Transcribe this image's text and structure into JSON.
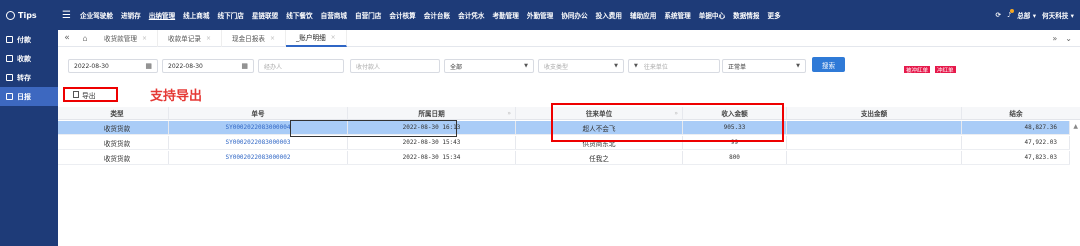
{
  "app": {
    "brand": "Tips",
    "menu_toggle": "☰"
  },
  "nav": [
    "企业驾驶舱",
    "进销存",
    "出纳管理",
    "线上商城",
    "线下门店",
    "星链联盟",
    "线下餐饮",
    "自营商城",
    "自营门店",
    "会计核算",
    "会计台账",
    "会计凭水",
    "考勤管理",
    "外勤管理",
    "协同办公",
    "投入费用",
    "辅助应用",
    "系统管理",
    "单据中心",
    "数据情报",
    "更多"
  ],
  "nav_active_index": 2,
  "top_right": {
    "user_label": "总部 ▾",
    "company_label": "何天科技 ▾"
  },
  "sidebar": [
    {
      "label": "付款"
    },
    {
      "label": "收款"
    },
    {
      "label": "转存"
    },
    {
      "label": "日报"
    }
  ],
  "sidebar_active_index": 3,
  "tabs": [
    {
      "label": "收货款管理"
    },
    {
      "label": "收款单记录"
    },
    {
      "label": "现金日报表"
    },
    {
      "label": "_账户明细"
    }
  ],
  "tab_active_index": 3,
  "filters": {
    "date_from": "2022-08-30",
    "date_to": "2022-08-30",
    "handler_placeholder": "经办人",
    "payee_placeholder": "收付款人",
    "account_select": "全部",
    "type_placeholder": "收支类型",
    "partner_placeholder": "往来单位",
    "status_select": "正常单",
    "search_label": "搜索",
    "tag_red": "被冲红单",
    "tag_reverse": "冲红单"
  },
  "toolbar": {
    "export_label": "导出",
    "annotation": "支持导出"
  },
  "table": {
    "columns": [
      "类型",
      "单号",
      "所属日期",
      "往来单位",
      "收入金额",
      "支出金额",
      "结余"
    ],
    "rows": [
      {
        "type": "收货货款",
        "no": "SY0002022083000004",
        "date": "2022-08-30 16:13",
        "partner": "超人不会飞",
        "income": "905.33",
        "expense": "",
        "balance": "48,827.36"
      },
      {
        "type": "收货货款",
        "no": "SY0002022083000003",
        "date": "2022-08-30 15:43",
        "partner": "供货商东北",
        "income": "99",
        "expense": "",
        "balance": "47,922.03"
      },
      {
        "type": "收货货款",
        "no": "SY0002022083000002",
        "date": "2022-08-30 15:34",
        "partner": "任我之",
        "income": "800",
        "expense": "",
        "balance": "47,823.03"
      }
    ]
  },
  "colors": {
    "topbar": "#1e3b78",
    "accent": "#2f7ad7",
    "selected_row": "#a9ccf7",
    "highlight": "#e00000"
  }
}
